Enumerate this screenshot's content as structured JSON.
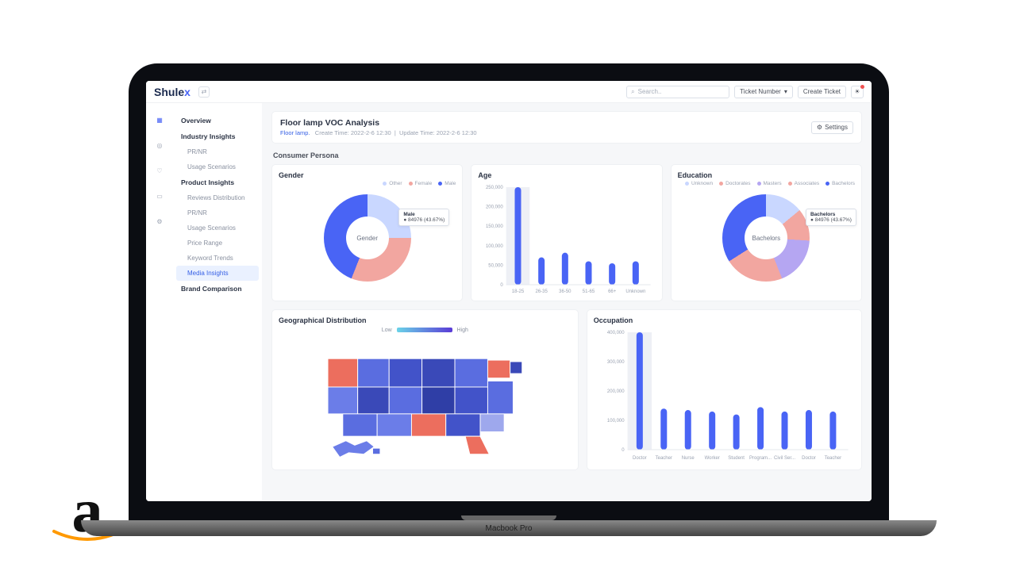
{
  "device": "Macbook Pro",
  "brand": "Shulex",
  "topbar": {
    "search_placeholder": "Search..",
    "filter_label": "Ticket Number",
    "create_label": "Create Ticket"
  },
  "sidenav": {
    "overview": "Overview",
    "industry_head": "Industry Insights",
    "industry": [
      "PR/NR",
      "Usage Scenarios"
    ],
    "product_head": "Product Insights",
    "product": [
      "Reviews Distribution",
      "PR/NR",
      "Usage Scenarios",
      "Price Range",
      "Keyword Trends",
      "Media Insights"
    ],
    "brand_comp": "Brand Comparison"
  },
  "header": {
    "title": "Floor lamp VOC Analysis",
    "crumb": "Floor lamp.",
    "create_label": "Create Time:",
    "create_time": "2022-2-6 12:30",
    "update_label": "Update Time:",
    "update_time": "2022-2-6 12:30",
    "settings": "Settings"
  },
  "section_title": "Consumer Persona",
  "cards": {
    "gender_title": "Gender",
    "age_title": "Age",
    "education_title": "Education",
    "geo_title": "Geographical Distribution",
    "occ_title": "Occupation",
    "gender_tooltip_label": "Male",
    "gender_tooltip_value": "● 84976  (43.67%)",
    "edu_tooltip_label": "Bachelors",
    "edu_tooltip_value": "● 84976  (43.67%)",
    "gender_center": "Gender",
    "edu_center": "Bachelors",
    "geo_low": "Low",
    "geo_high": "High"
  },
  "chart_data": [
    {
      "type": "pie",
      "id": "gender",
      "series": [
        {
          "name": "Other",
          "value": 25,
          "color": "#c9d7ff"
        },
        {
          "name": "Female",
          "value": 31,
          "color": "#f2a6a0"
        },
        {
          "name": "Male",
          "value": 44,
          "color": "#4964f5"
        }
      ],
      "title": "Gender",
      "tooltip": {
        "name": "Male",
        "count": 84976,
        "pct": 43.67
      }
    },
    {
      "type": "bar",
      "id": "age",
      "categories": [
        "18-25",
        "26-35",
        "36-50",
        "51-65",
        "66+",
        "Unknown"
      ],
      "values": [
        250000,
        70000,
        82000,
        60000,
        55000,
        60000
      ],
      "ylim": [
        0,
        250000
      ],
      "yticks": [
        50000,
        100000,
        150000,
        200000,
        250000
      ],
      "title": "Age"
    },
    {
      "type": "pie",
      "id": "education",
      "series": [
        {
          "name": "Unknown",
          "value": 14,
          "color": "#c9d7ff"
        },
        {
          "name": "Doctorates",
          "value": 12,
          "color": "#f2a6a0"
        },
        {
          "name": "Masters",
          "value": 18,
          "color": "#b5a6f2"
        },
        {
          "name": "Associates",
          "value": 22,
          "color": "#f2a6a0"
        },
        {
          "name": "Bachelors",
          "value": 34,
          "color": "#4964f5"
        }
      ],
      "title": "Education",
      "tooltip": {
        "name": "Bachelors",
        "count": 84976,
        "pct": 43.67
      }
    },
    {
      "type": "heatmap",
      "id": "geo",
      "title": "Geographical Distribution",
      "scale": {
        "low": "#6ad3e8",
        "high": "#5a3bd6"
      }
    },
    {
      "type": "bar",
      "id": "occupation",
      "categories": [
        "Doctor",
        "Teacher",
        "Nurse",
        "Worker",
        "Student",
        "Program...",
        "Civil Ser...",
        "Doctor",
        "Teacher"
      ],
      "values": [
        400000,
        140000,
        135000,
        130000,
        120000,
        145000,
        130000,
        135000,
        130000
      ],
      "ylim": [
        0,
        400000
      ],
      "yticks": [
        100000,
        200000,
        300000,
        400000
      ],
      "title": "Occupation"
    }
  ]
}
